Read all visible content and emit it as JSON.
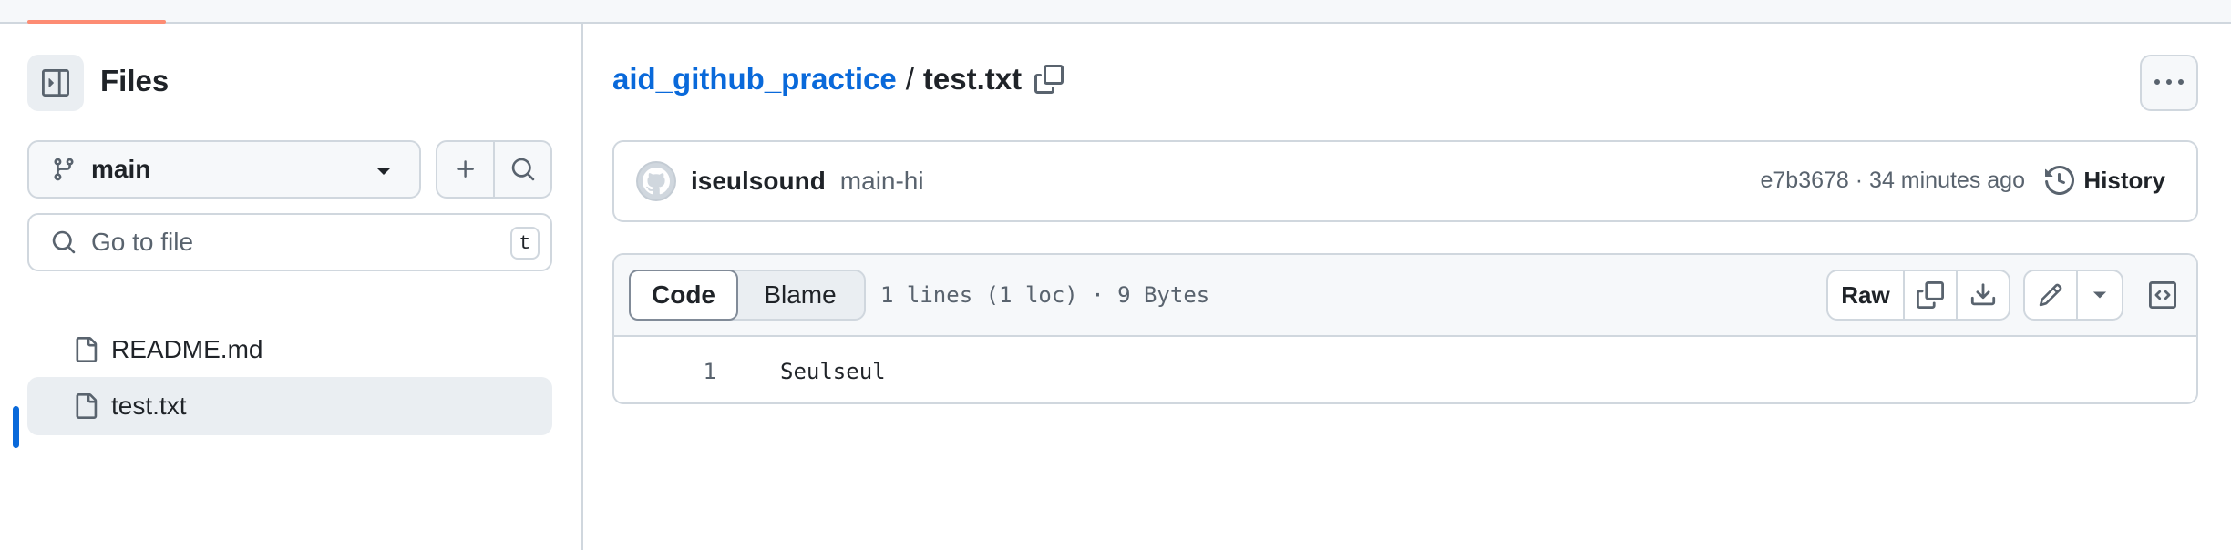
{
  "sidebar": {
    "title": "Files",
    "branch": "main",
    "search": {
      "placeholder": "Go to file",
      "shortcut": "t"
    },
    "files": [
      {
        "name": "README.md",
        "active": false
      },
      {
        "name": "test.txt",
        "active": true
      }
    ]
  },
  "breadcrumb": {
    "repo": "aid_github_practice",
    "separator": "/",
    "file": "test.txt"
  },
  "commit": {
    "author": "iseulsound",
    "message": "main-hi",
    "meta": "e7b3678 · 34 minutes ago",
    "history_label": "History"
  },
  "file_view": {
    "tabs": [
      "Code",
      "Blame"
    ],
    "selected_tab": "Code",
    "info": "1 lines (1 loc) · 9 Bytes",
    "raw_label": "Raw",
    "lines": [
      {
        "number": "1",
        "text": "Seulseul"
      }
    ]
  },
  "colors": {
    "link": "#0969da",
    "border": "#d0d7de",
    "muted": "#59636e",
    "active_marker": "#0969da",
    "tab_underline": "#fd8c73"
  }
}
